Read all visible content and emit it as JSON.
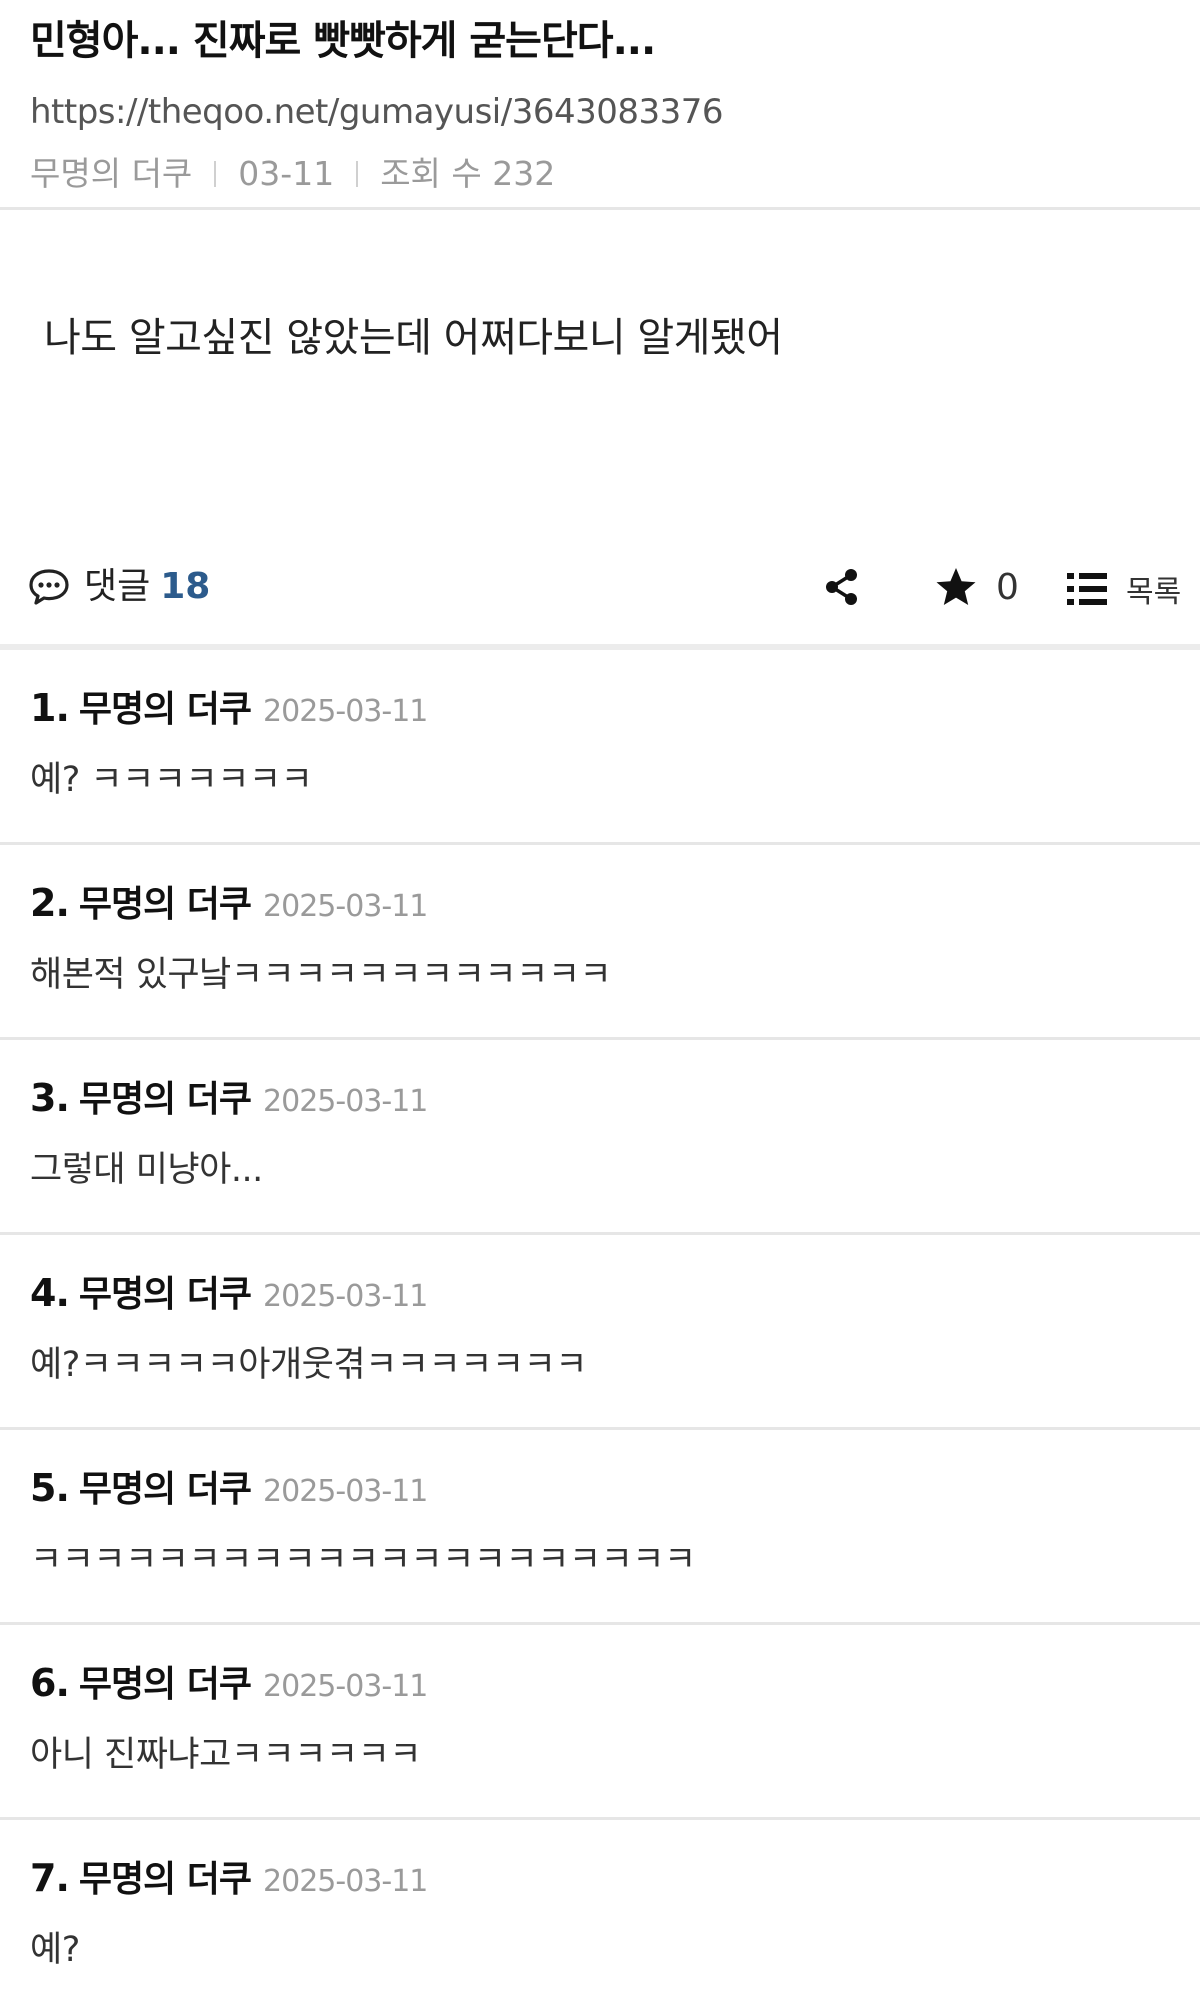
{
  "post": {
    "title": "민형아... 진짜로 빳빳하게 굳는단다...",
    "url": "https://theqoo.net/gumayusi/3643083376",
    "author": "무명의 더쿠",
    "date": "03-11",
    "views": "조회 수 232",
    "body": "나도 알고싶진 않았는데 어쩌다보니 알게됐어"
  },
  "actions": {
    "comment_label": "댓글",
    "comment_count": "18",
    "star_count": "0",
    "list_label": "목록",
    "icons": {
      "comment": "speech-bubble-icon",
      "share": "share-icon",
      "star": "star-icon",
      "list": "list-icon"
    }
  },
  "comments": [
    {
      "num": "1.",
      "author": "무명의 더쿠",
      "date": "2025-03-11",
      "text": "예? ㅋㅋㅋㅋㅋㅋㅋ"
    },
    {
      "num": "2.",
      "author": "무명의 더쿠",
      "date": "2025-03-11",
      "text": "해본적 있구낰ㅋㅋㅋㅋㅋㅋㅋㅋㅋㅋㅋㅋ"
    },
    {
      "num": "3.",
      "author": "무명의 더쿠",
      "date": "2025-03-11",
      "text": "그렇대 미냥아..."
    },
    {
      "num": "4.",
      "author": "무명의 더쿠",
      "date": "2025-03-11",
      "text": "예?ㅋㅋㅋㅋㅋ아개웃겪ㅋㅋㅋㅋㅋㅋㅋ"
    },
    {
      "num": "5.",
      "author": "무명의 더쿠",
      "date": "2025-03-11",
      "text": "ㅋㅋㅋㅋㅋㅋㅋㅋㅋㅋㅋㅋㅋㅋㅋㅋㅋㅋㅋㅋㅋ"
    },
    {
      "num": "6.",
      "author": "무명의 더쿠",
      "date": "2025-03-11",
      "text": "아니 진짜냐고ㅋㅋㅋㅋㅋㅋ"
    },
    {
      "num": "7.",
      "author": "무명의 더쿠",
      "date": "2025-03-11",
      "text": "예?"
    }
  ],
  "colors": {
    "accent_count": "#2c5b8c",
    "meta_gray": "#9a9a9a",
    "divider": "#e6e6e6"
  }
}
